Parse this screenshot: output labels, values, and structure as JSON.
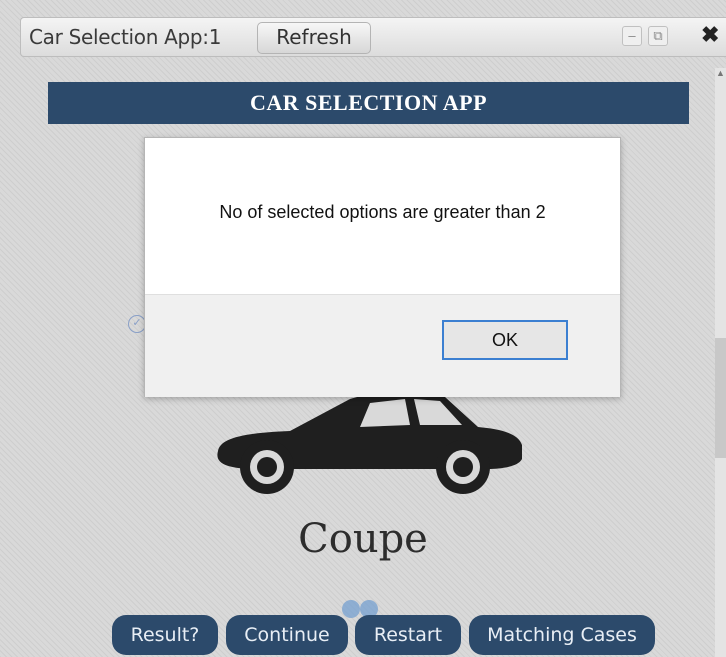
{
  "window": {
    "title": "Car Selection App:1",
    "refresh_label": "Refresh",
    "min_glyph": "–",
    "restore_glyph": "⧉",
    "close_glyph": "✖"
  },
  "app": {
    "header": "CAR SELECTION APP",
    "car_label": "Coupe",
    "car_icon": "coupe-car-icon"
  },
  "buttons": {
    "result": "Result?",
    "continue": "Continue",
    "restart": "Restart",
    "matching_cases": "Matching Cases"
  },
  "dialog": {
    "message": "No of selected options are greater than 2",
    "ok": "OK"
  },
  "colors": {
    "header_bg": "#2c4a6b",
    "button_bg": "#2c4a6b",
    "ok_border": "#3b7fd1"
  }
}
